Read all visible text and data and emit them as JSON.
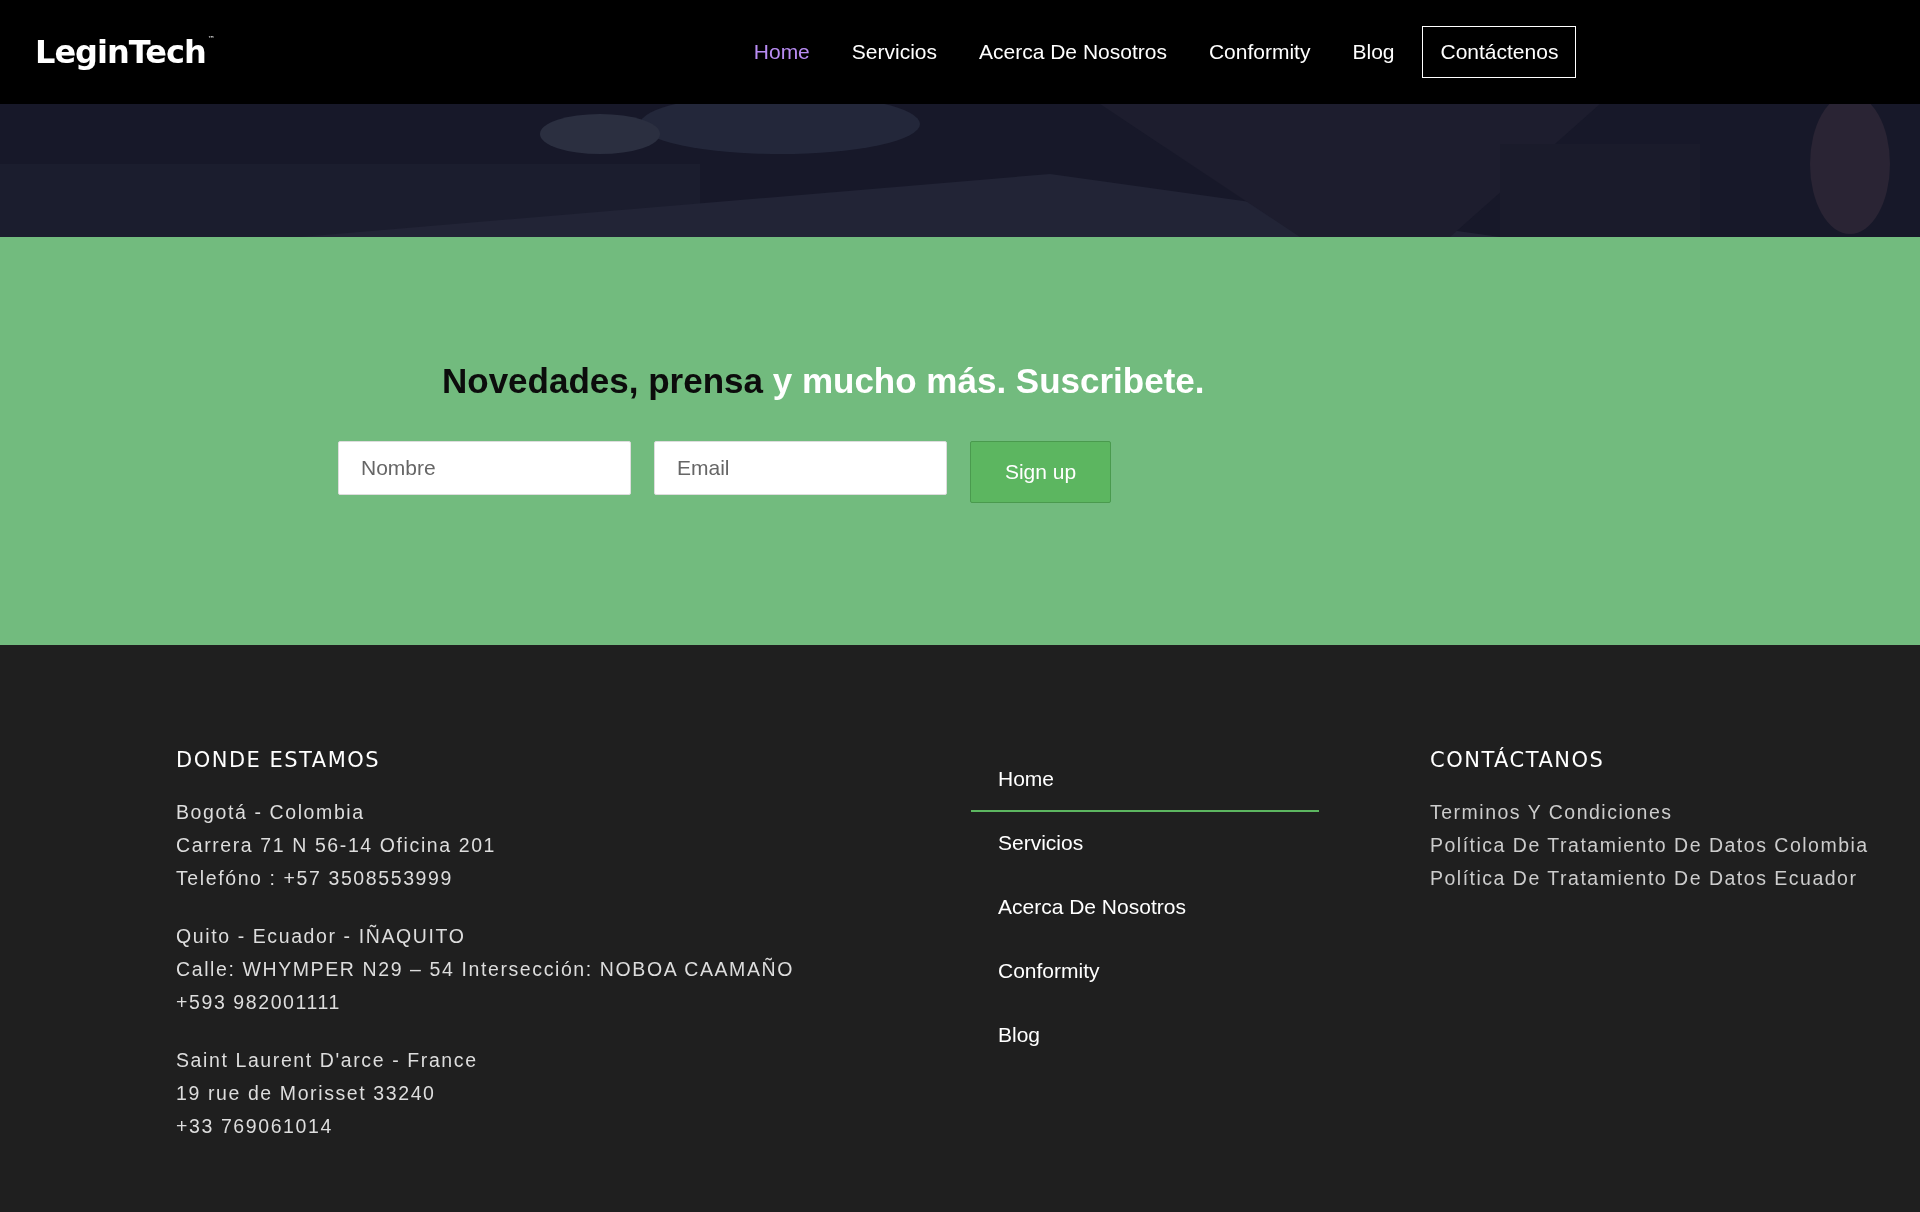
{
  "header": {
    "logo": {
      "text": "LeginTech",
      "mark": "™"
    },
    "nav": [
      {
        "label": "Home",
        "selected": true,
        "kind": "link"
      },
      {
        "label": "Servicios",
        "selected": false,
        "kind": "link"
      },
      {
        "label": "Acerca De Nosotros",
        "selected": false,
        "kind": "link"
      },
      {
        "label": "Conformity",
        "selected": false,
        "kind": "link"
      },
      {
        "label": "Blog",
        "selected": false,
        "kind": "link"
      },
      {
        "label": "Contáctenos",
        "selected": false,
        "kind": "button"
      }
    ]
  },
  "newsletter": {
    "heading": {
      "dark": "Novedades, prensa",
      "light": "y mucho más. Suscribete."
    },
    "name_field": {
      "placeholder": "Nombre"
    },
    "email_field": {
      "placeholder": "Email"
    },
    "button": "Sign up"
  },
  "footer": {
    "locations": {
      "title": "DONDE ESTAMOS",
      "blocks": [
        [
          "Bogotá - Colombia",
          "Carrera 71 N 56-14 Oficina 201",
          "Telefóno : +57 3508553999"
        ],
        [
          "Quito - Ecuador - IÑAQUITO",
          "Calle: WHYMPER N29 – 54 Intersección: NOBOA CAAMAÑO",
          "+593 982001111"
        ],
        [
          "Saint Laurent D'arce - France",
          "19 rue de Morisset 33240",
          "+33 769061014"
        ]
      ]
    },
    "menu": [
      {
        "label": "Home",
        "selected": true
      },
      {
        "label": "Servicios",
        "selected": false
      },
      {
        "label": "Acerca De Nosotros",
        "selected": false
      },
      {
        "label": "Conformity",
        "selected": false
      },
      {
        "label": "Blog",
        "selected": false
      }
    ],
    "contact": {
      "title": "CONTÁCTANOS",
      "links": [
        "Terminos Y Condiciones",
        "Política De Tratamiento De Datos Colombia",
        "Política De Tratamiento De Datos Ecuador"
      ]
    }
  }
}
